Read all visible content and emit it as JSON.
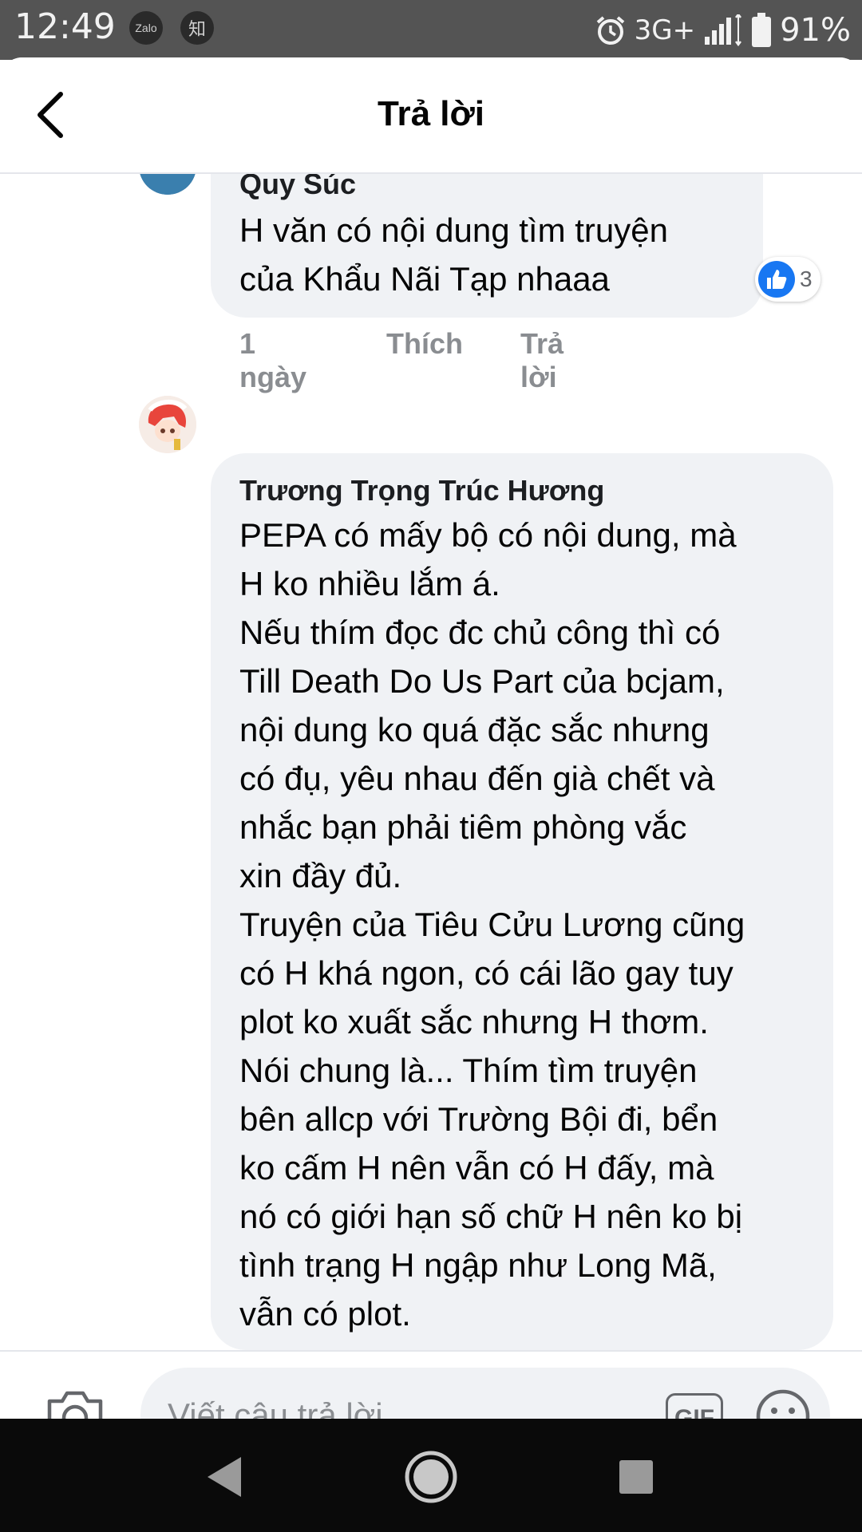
{
  "status_bar": {
    "time": "12:49",
    "app1": "Zalo",
    "app2": "知",
    "network": "3G+",
    "battery": "91%"
  },
  "header": {
    "title": "Trả lời"
  },
  "comments": [
    {
      "author": "Quy Súc",
      "text": "H văn có nội dung tìm truyện\ncủa Khẩu Nãi Tạp nhaaa",
      "time": "1 ngày",
      "like_label": "Thích",
      "reply_label": "Trả lời",
      "reaction_count": "3"
    },
    {
      "author": "Trương Trọng Trúc Hương",
      "text": "PEPA có mấy bộ có nội dung, mà\nH ko nhiều lắm á.\nNếu thím đọc đc chủ công thì có\nTill Death Do Us Part của bcjam,\nnội dung ko quá đặc sắc nhưng\ncó đụ, yêu nhau đến già chết và\nnhắc bạn phải tiêm phòng vắc\nxin đầy đủ.\nTruyện của Tiêu Cửu Lương cũng\ncó H khá ngon, có cái lão gay tuy\nplot ko xuất sắc nhưng H thơm.\nNói chung là... Thím tìm truyện\nbên allcp với Trường Bội đi, bển\nko cấm H nên vẫn có H đấy, mà\nnó có giới hạn số chữ H nên ko bị\ntình trạng H ngập như Long Mã,\nvẫn có plot."
    }
  ],
  "composer": {
    "placeholder": "Viết câu trả lời...",
    "gif_label": "GIF"
  },
  "colors": {
    "accent": "#1877f2",
    "bubble": "#f0f2f5",
    "meta": "#8a8d91"
  }
}
